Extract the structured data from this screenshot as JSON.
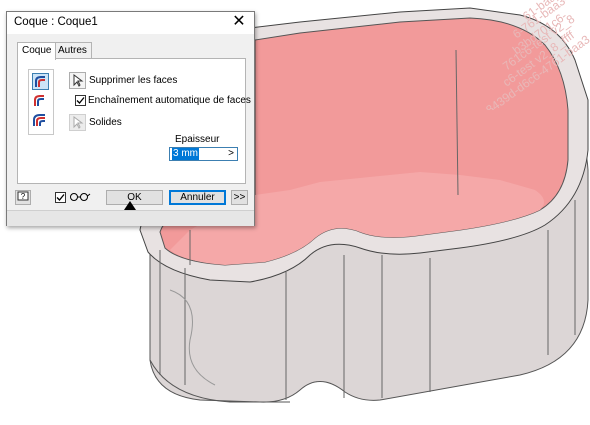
{
  "dialog": {
    "title": "Coque : Coque1",
    "close_glyph": "✕"
  },
  "tabs": [
    {
      "label": "Coque",
      "active": true
    },
    {
      "label": "Autres",
      "active": false
    }
  ],
  "panel": {
    "icons": [
      "shell-inside-icon",
      "shell-outside-icon",
      "shell-both-icon"
    ],
    "remove_faces_label": "Supprimer les faces",
    "auto_chain_label": "Enchaînement automatique de faces",
    "auto_chain_checked": true,
    "solids_label": "Solides",
    "thickness_label": "Epaisseur",
    "thickness_value": "3 mm"
  },
  "footer": {
    "help_icon": "help-icon",
    "preview_checked": true,
    "preview_icon": "glasses-icon",
    "ok_label": "OK",
    "cancel_label": "Annuler",
    "more_label": ">>"
  },
  "watermark": [
    "61-baa3-0",
    "6-761-baa3-",
    "b3bd701c6-",
    "761c6-test v2_8",
    "c6-test v2_8_ffff",
    "-8439d-d6c6-4761-baa3"
  ],
  "colors": {
    "shell_inner": "#f29a9a",
    "shell_outer": "#d9d4d4",
    "accent": "#0078d7"
  }
}
